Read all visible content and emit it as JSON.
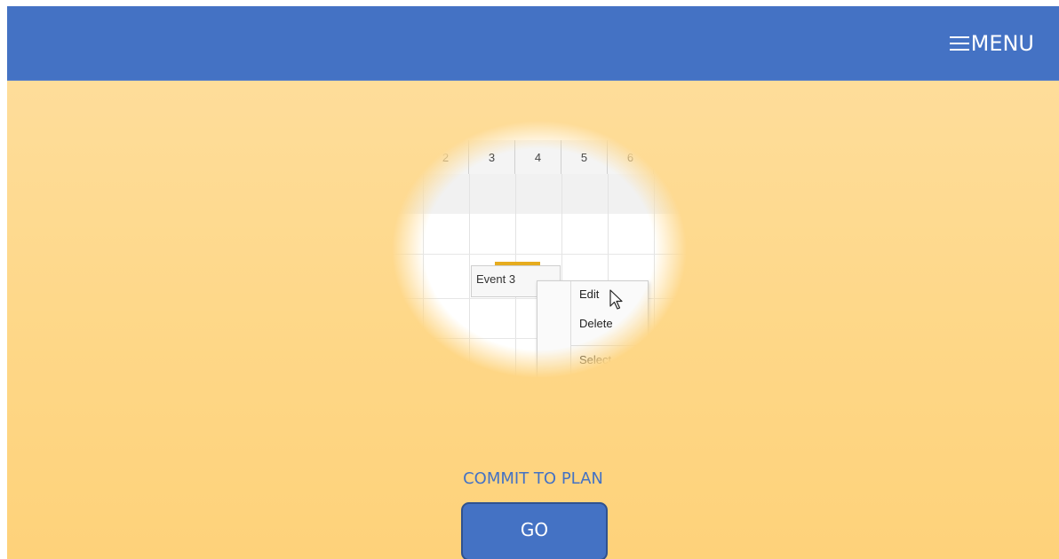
{
  "header": {
    "menu_label": "MENU",
    "menu_icon": "hamburger-icon",
    "bar_color": "#4472c4"
  },
  "illustration": {
    "day_columns": [
      "2",
      "3",
      "4",
      "5",
      "6"
    ],
    "event_label": "Event 3",
    "context_menu": {
      "items": [
        "Edit",
        "Delete",
        "Select"
      ]
    },
    "cursor_icon": "pointer-cursor-icon"
  },
  "main": {
    "commit_label": "COMMIT TO PLAN",
    "go_label": "GO",
    "background_color": "#fed787",
    "accent_color": "#4472c4"
  }
}
